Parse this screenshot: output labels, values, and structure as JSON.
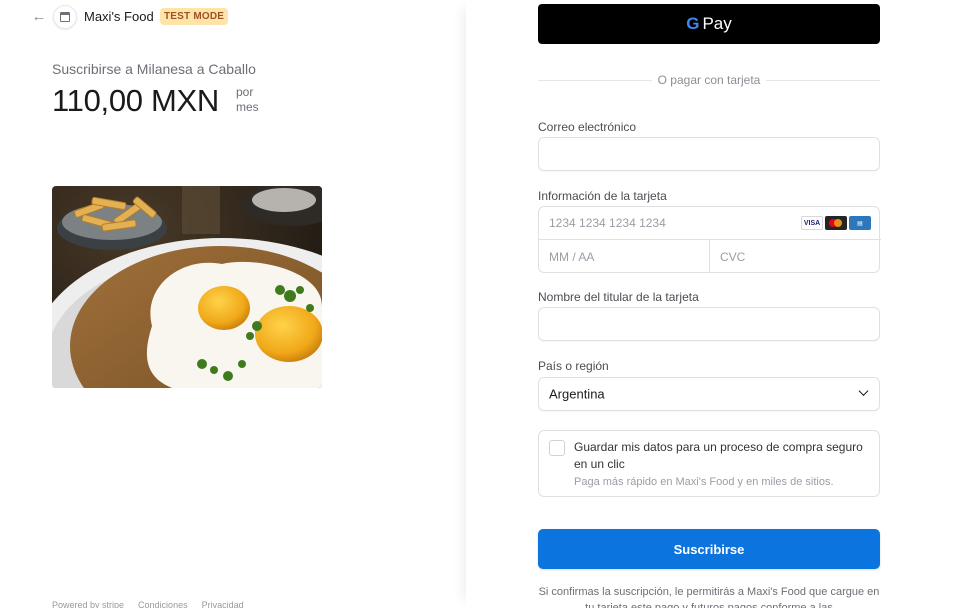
{
  "header": {
    "merchant_name": "Maxi's Food",
    "test_badge": "TEST MODE"
  },
  "product": {
    "subscribe_title": "Suscribirse a Milanesa a Caballo",
    "price": "110,00 MXN",
    "per_line1": "por",
    "per_line2": "mes"
  },
  "footer": {
    "powered": "Powered by stripe",
    "terms": "Condiciones",
    "privacy": "Privacidad"
  },
  "payment": {
    "gpay_label": "Pay",
    "divider_text": "O pagar con tarjeta",
    "email_label": "Correo electrónico",
    "card_label": "Información de la tarjeta",
    "card_number_placeholder": "1234 1234 1234 1234",
    "expiry_placeholder": "MM / AA",
    "cvc_placeholder": "CVC",
    "brands": [
      "VISA",
      "mastercard",
      "AMEX"
    ],
    "cardholder_label": "Nombre del titular de la tarjeta",
    "country_label": "País o región",
    "country_value": "Argentina",
    "save_text": "Guardar mis datos para un proceso de compra seguro en un clic",
    "save_subtext": "Paga más rápido en Maxi's Food y en miles de sitios.",
    "submit_label": "Suscribirse",
    "terms_text": "Si confirmas la suscripción, le permitirás a Maxi's Food que cargue en tu tarjeta este pago y futuros pagos conforme a las"
  },
  "colors": {
    "accent": "#0b74de",
    "badge_bg": "#fde4a8",
    "badge_text": "#a3501f"
  }
}
